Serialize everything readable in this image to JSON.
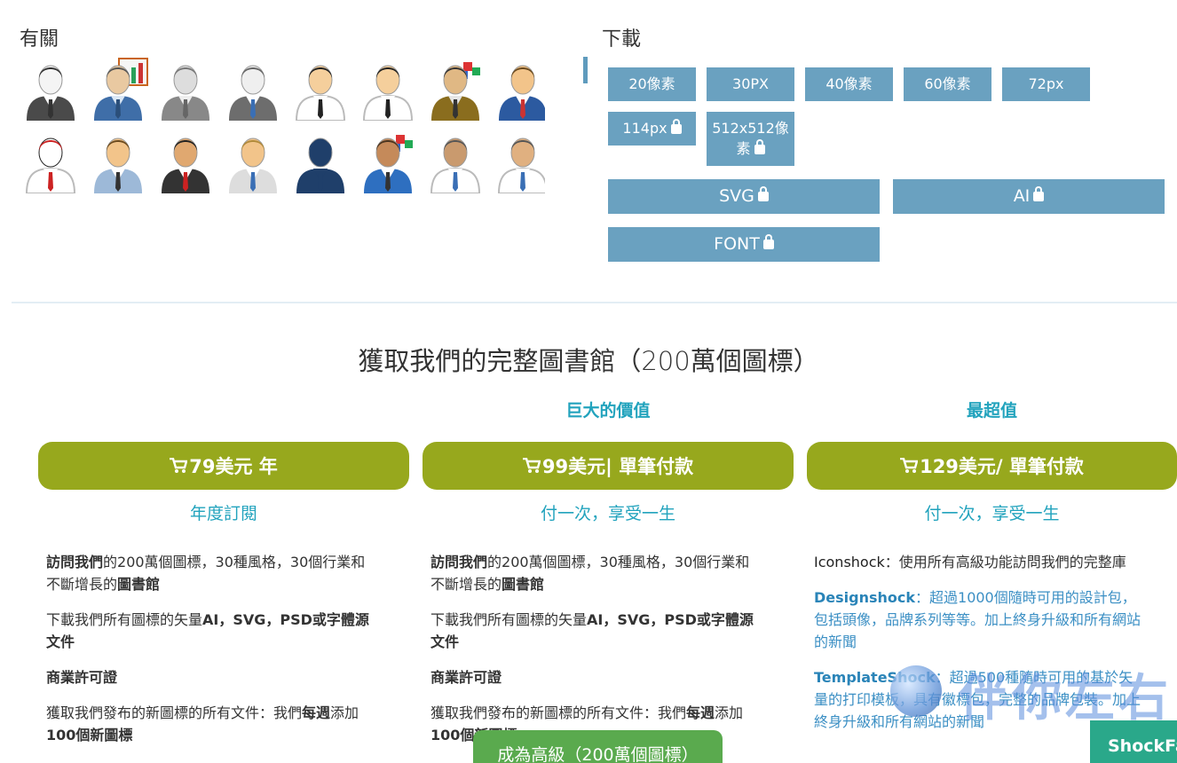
{
  "related": {
    "title": "有關",
    "icons": [
      "businessman-gray-suit",
      "businessman-chart",
      "businessman-grayscale",
      "businessman-gray-hair",
      "businessman-white-shirt-tie",
      "businessman-white-shirt",
      "businessman-olive-cubes",
      "businessman-blue-shirt",
      "businessman-red-hair",
      "businessman-blue-suit",
      "businessman-dark-suit",
      "businessman-blond",
      "businessman-silhouette-navy",
      "businessman-blue-cubes",
      "businessman-white-shirt-2",
      "businessman-white-shirt-3"
    ]
  },
  "download": {
    "title": "下載",
    "sizes": [
      {
        "label": "20像素",
        "locked": false
      },
      {
        "label": "30PX",
        "locked": false
      },
      {
        "label": "40像素",
        "locked": false
      },
      {
        "label": "60像素",
        "locked": false
      },
      {
        "label": "72px",
        "locked": false
      },
      {
        "label": "114px",
        "locked": true
      },
      {
        "label": "512x512像素",
        "locked": true
      }
    ],
    "formats": [
      {
        "label": "SVG",
        "locked": true
      },
      {
        "label": "AI",
        "locked": true
      },
      {
        "label": "FONT",
        "locked": true
      }
    ]
  },
  "library_title": "獲取我們的完整圖書館（200萬個圖標）",
  "plans": [
    {
      "tag": "",
      "price": "79美元 年",
      "sub": "年度訂閱",
      "features": [
        {
          "b1": "訪問我們",
          "t1": "的200萬個圖標，30種風格，30個行業和不斷增長的",
          "b2": "圖書館"
        },
        {
          "t1": "下載我們所有圖標的矢量",
          "b1": "AI，SVG，PSD或字體源文件"
        },
        {
          "b1": "商業許可證"
        },
        {
          "t1": "獲取我們發布的新圖標的所有文件：我們",
          "b1": "每週",
          "t2": "添加",
          "b2": "100個新圖標"
        }
      ]
    },
    {
      "tag": "巨大的價值",
      "price": "99美元| 單筆付款",
      "sub": "付一次，享受一生",
      "features": [
        {
          "b1": "訪問我們",
          "t1": "的200萬個圖標，30種風格，30個行業和不斷增長的",
          "b2": "圖書館"
        },
        {
          "t1": "下載我們所有圖標的矢量",
          "b1": "AI，SVG，PSD或字體源文件"
        },
        {
          "b1": "商業許可證"
        },
        {
          "t1": "獲取我們發布的新圖標的所有文件：我們",
          "b1": "每週",
          "t2": "添加",
          "b2": "100個新圖標"
        }
      ]
    },
    {
      "tag": "最超值",
      "price": "129美元/ 單筆付款",
      "sub": "付一次，享受一生",
      "extras": [
        {
          "name": "Iconshock",
          "text": "：使用所有高級功能訪問我們的完整庫"
        },
        {
          "name": "Designshock",
          "text": "：超過1000個隨時可用的設計包，包括頭像，品牌系列等等。加上終身升級和所有網站的新聞"
        },
        {
          "name": "TemplateShock",
          "text": "：超過500種隨時可用的基於矢量的打印模板，具有徽標包，完整的品牌包裝。加上終身升級和所有網站的新聞"
        }
      ]
    }
  ],
  "cta": "成為高級（200萬個圖標）",
  "watermark": "伴你左右",
  "badge": "ShockFa"
}
